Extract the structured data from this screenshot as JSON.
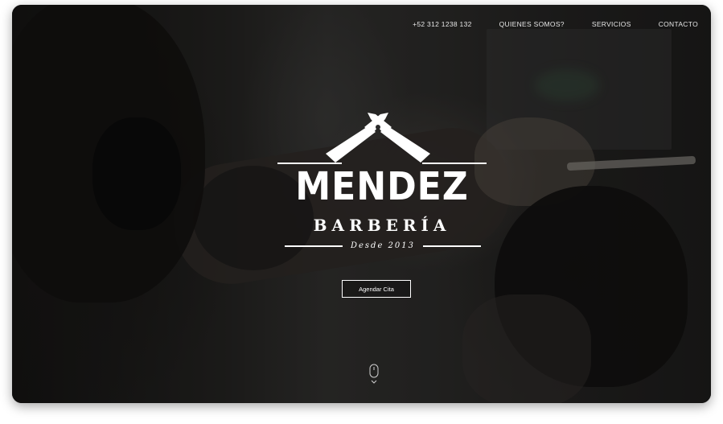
{
  "nav": {
    "phone": "+52 312 1238 132",
    "about": "QUIENES SOMOS?",
    "services": "SERVICIOS",
    "contact": "CONTACTO"
  },
  "logo": {
    "name": "MENDEZ",
    "subtitle": "BARBERÍA",
    "since": "Desde 2013",
    "icon": "crossed-razors-icon"
  },
  "cta": {
    "label": "Agendar Cita"
  },
  "scroll_hint": {
    "icon": "mouse-scroll-icon"
  },
  "colors": {
    "text": "#ffffff",
    "background": "#1a1a1a"
  }
}
